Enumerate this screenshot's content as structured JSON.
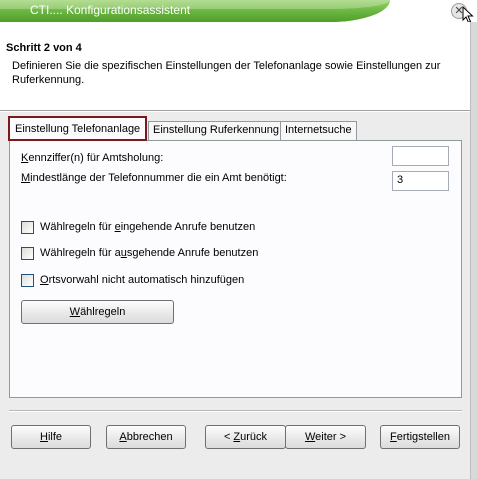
{
  "window": {
    "title": "CTI.... Konfigurationsassistent",
    "close_glyph": "✕"
  },
  "header": {
    "step_title": "Schritt 2 von 4",
    "description": "Definieren Sie die spezifischen Einstellungen der Telefonanlage sowie Einstellungen zur Ruferkennung."
  },
  "tabs": [
    {
      "label": "Einstellung Telefonanlage",
      "active": true
    },
    {
      "label": "Einstellung Ruferkennung",
      "active": false
    },
    {
      "label": "Internetsuche",
      "active": false
    }
  ],
  "form": {
    "amtsholung": {
      "label_pre": "",
      "label_u": "K",
      "label_post": "ennziffer(n) für Amtsholung:",
      "value": ""
    },
    "mindestlaenge": {
      "label_pre": "",
      "label_u": "M",
      "label_post": "indestlänge der Telefonnummer die ein Amt benötigt:",
      "value": "3"
    },
    "checkboxes": [
      {
        "pre": "Wählregeln für ",
        "u": "e",
        "post": "ingehende Anrufe benutzen",
        "checked": false
      },
      {
        "pre": "Wählregeln für a",
        "u": "u",
        "post": "sgehende Anrufe benutzen",
        "checked": false
      },
      {
        "pre": "",
        "u": "O",
        "post": "rtsvorwahl nicht automatisch hinzufügen",
        "checked": false
      }
    ],
    "waehlregeln_button": {
      "pre": "",
      "u": "W",
      "post": "ählregeln"
    }
  },
  "buttons": {
    "hilfe": {
      "pre": "",
      "u": "H",
      "post": "ilfe"
    },
    "abbrechen": {
      "pre": "",
      "u": "A",
      "post": "bbrechen"
    },
    "zurueck": {
      "pre": "< ",
      "u": "Z",
      "post": "urück"
    },
    "weiter": {
      "pre": "",
      "u": "W",
      "post": "eiter >"
    },
    "fertigstellen": {
      "pre": "",
      "u": "F",
      "post": "ertigstellen"
    }
  }
}
